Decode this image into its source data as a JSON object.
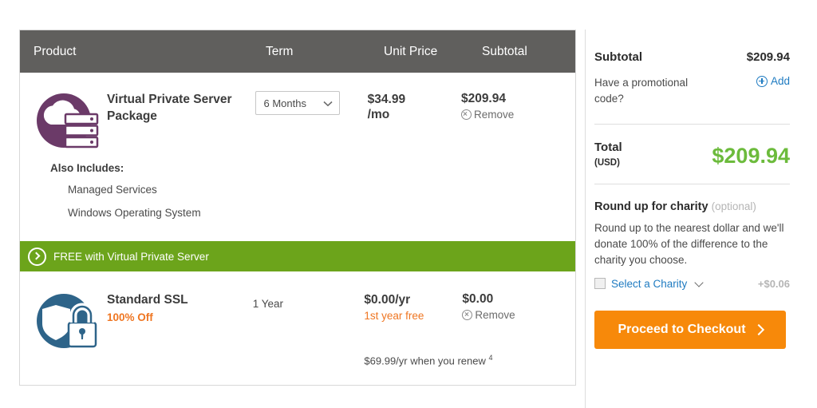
{
  "cart": {
    "columns": {
      "product": "Product",
      "term": "Term",
      "unit_price": "Unit Price",
      "subtotal": "Subtotal"
    },
    "items": [
      {
        "icon": "vps-cloud-server-icon",
        "name": "Virtual Private Server Package",
        "term_value": "6 Months",
        "unit_price": "$34.99",
        "unit_price_suffix": "/mo",
        "subtotal": "$209.94",
        "remove_label": "Remove",
        "also_includes_title": "Also Includes:",
        "also_includes": [
          "Managed Services",
          "Windows Operating System"
        ]
      },
      {
        "icon": "ssl-shield-lock-icon",
        "name": "Standard SSL",
        "discount": "100% Off",
        "term_value": "1 Year",
        "unit_price": "$0.00/yr",
        "unit_note": "1st year free",
        "subtotal": "$0.00",
        "remove_label": "Remove",
        "renew_note": "$69.99/yr when you renew",
        "renew_footnote": "4"
      }
    ],
    "free_banner": {
      "icon": "chevron-right-circle-icon",
      "text": "FREE with Virtual Private Server"
    }
  },
  "summary": {
    "subtotal_label": "Subtotal",
    "subtotal_value": "$209.94",
    "promo_question": "Have a promotional code?",
    "promo_add_label": "Add",
    "total_label": "Total",
    "total_currency": "(USD)",
    "total_value": "$209.94",
    "charity_title": "Round up for charity",
    "charity_optional": "(optional)",
    "charity_description": "Round up to the nearest dollar and we'll donate 100% of the difference to the charity you choose.",
    "charity_select_label": "Select a Charity",
    "charity_amount": "+$0.06",
    "checkout_label": "Proceed to Checkout"
  },
  "colors": {
    "header_gray": "#605f5d",
    "vps_purple": "#6b3a68",
    "ssl_blue": "#2e6489",
    "free_green": "#6ca41b",
    "total_green": "#6cbb3c",
    "checkout_orange": "#f7890a",
    "link_blue": "#1f7bc1",
    "discount_orange": "#ef7622"
  }
}
